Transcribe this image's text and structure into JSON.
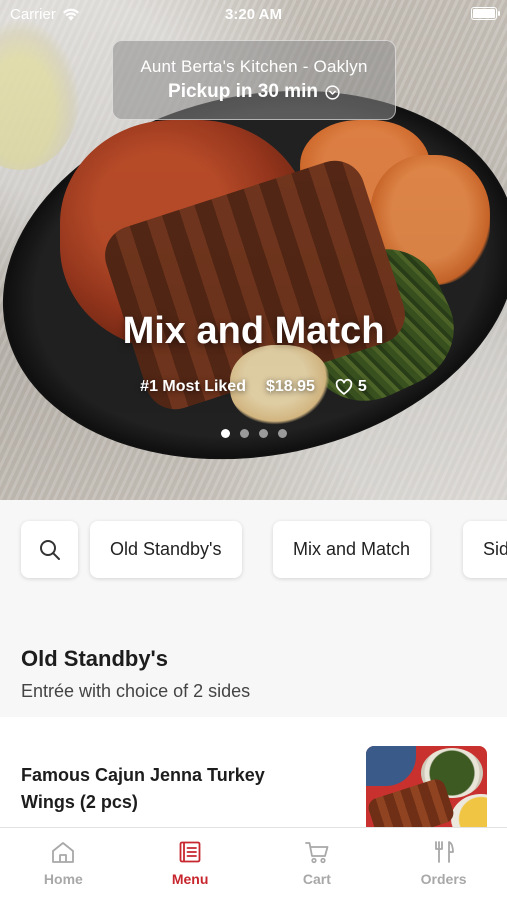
{
  "status_bar": {
    "carrier": "Carrier",
    "time": "3:20 AM"
  },
  "pickup": {
    "store": "Aunt Berta's Kitchen - Oaklyn",
    "eta": "Pickup in 30 min"
  },
  "hero": {
    "title": "Mix and Match",
    "badge": "#1 Most Liked",
    "price": "$18.95",
    "likes": "5",
    "carousel_total": 4,
    "carousel_active": 1
  },
  "categories": [
    {
      "label": "Old Standby's"
    },
    {
      "label": "Mix and Match"
    },
    {
      "label": "Sides"
    }
  ],
  "section": {
    "title": "Old Standby's",
    "subtitle": "Entrée with choice of 2 sides"
  },
  "items": [
    {
      "name": "Famous Cajun Jenna Turkey Wings (2 pcs)"
    }
  ],
  "tabs": [
    {
      "label": "Home",
      "icon": "home-icon",
      "active": false
    },
    {
      "label": "Menu",
      "icon": "menu-icon",
      "active": true
    },
    {
      "label": "Cart",
      "icon": "cart-icon",
      "active": false
    },
    {
      "label": "Orders",
      "icon": "orders-icon",
      "active": false
    }
  ],
  "colors": {
    "accent": "#c8262e",
    "inactive_tab": "#a8a8a8",
    "background": "#f7f7f7"
  }
}
